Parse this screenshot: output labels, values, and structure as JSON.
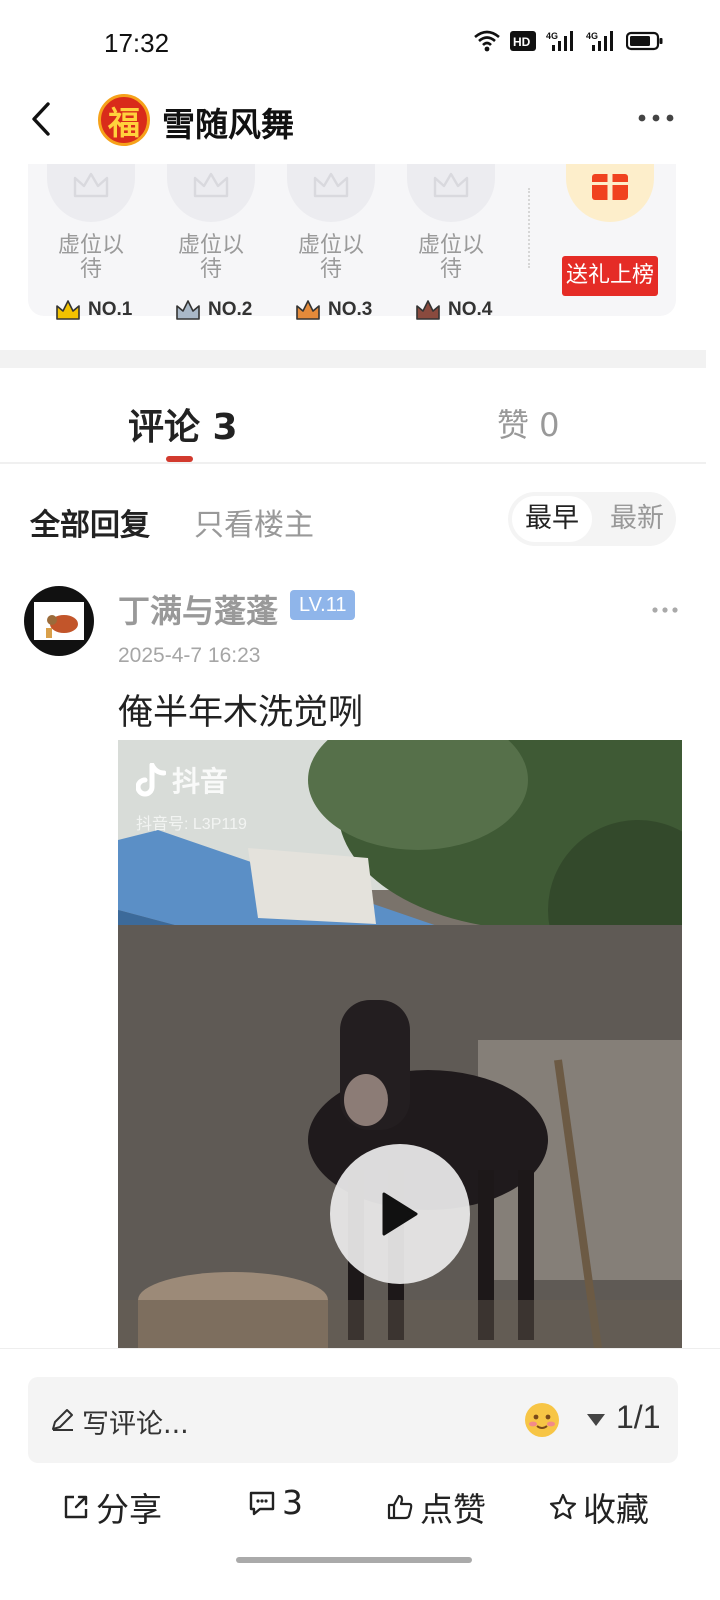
{
  "status_bar": {
    "time": "17:32",
    "icons": [
      "wifi-icon",
      "hd-icon",
      "signal-4g-icon",
      "signal-4g-icon",
      "battery-icon"
    ]
  },
  "header": {
    "title": "雪随风舞",
    "avatar_char": "福",
    "icons": [
      "back-arrow-icon",
      "more-icon"
    ]
  },
  "ranking": {
    "slots": [
      {
        "label": "虚位以待",
        "rank": "NO.1",
        "crown_color": "#f2c200"
      },
      {
        "label": "虚位以待",
        "rank": "NO.2",
        "crown_color": "#a9b8c8"
      },
      {
        "label": "虚位以待",
        "rank": "NO.3",
        "crown_color": "#e48a3a"
      },
      {
        "label": "虚位以待",
        "rank": "NO.4",
        "crown_color": "#8a4a3e"
      }
    ],
    "gift_button": "送礼上榜",
    "gift_icon": "gift-icon"
  },
  "tabs": {
    "comments": "评论 3",
    "likes": "赞 0"
  },
  "filters": {
    "all_replies": "全部回复",
    "owner_only": "只看楼主",
    "sort_earliest": "最早",
    "sort_latest": "最新"
  },
  "comment": {
    "username": "丁满与蓬蓬",
    "level": "LV.11",
    "timestamp": "2025-4-7 16:23",
    "text": "俺半年木洗觉咧",
    "video": {
      "watermark_app": "抖音",
      "watermark_id": "抖音号: L3P119"
    }
  },
  "bottom_bar": {
    "write_placeholder": "写评论...",
    "page_indicator": "1/1",
    "actions": {
      "share": "分享",
      "comment_count": "3",
      "like": "点赞",
      "favorite": "收藏"
    }
  },
  "colors": {
    "accent_red": "#d23a2e",
    "gift_red": "#e52c26",
    "level_blue": "#8fb5ea"
  }
}
